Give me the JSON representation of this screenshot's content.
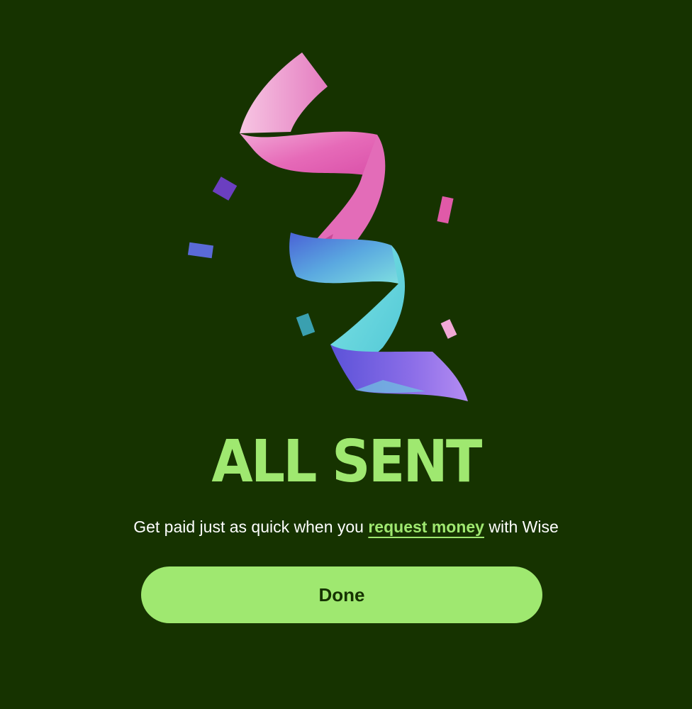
{
  "heading": "ALL SENT",
  "message": {
    "prefix": "Get paid just as quick when you",
    "link_text": "request money",
    "suffix": "with Wise"
  },
  "done_button": {
    "label": "Done"
  },
  "illustration": {
    "icon": "confetti-ribbon-icon"
  },
  "colors": {
    "background": "#163300",
    "accent": "#9fe870",
    "text": "#ffffff"
  }
}
